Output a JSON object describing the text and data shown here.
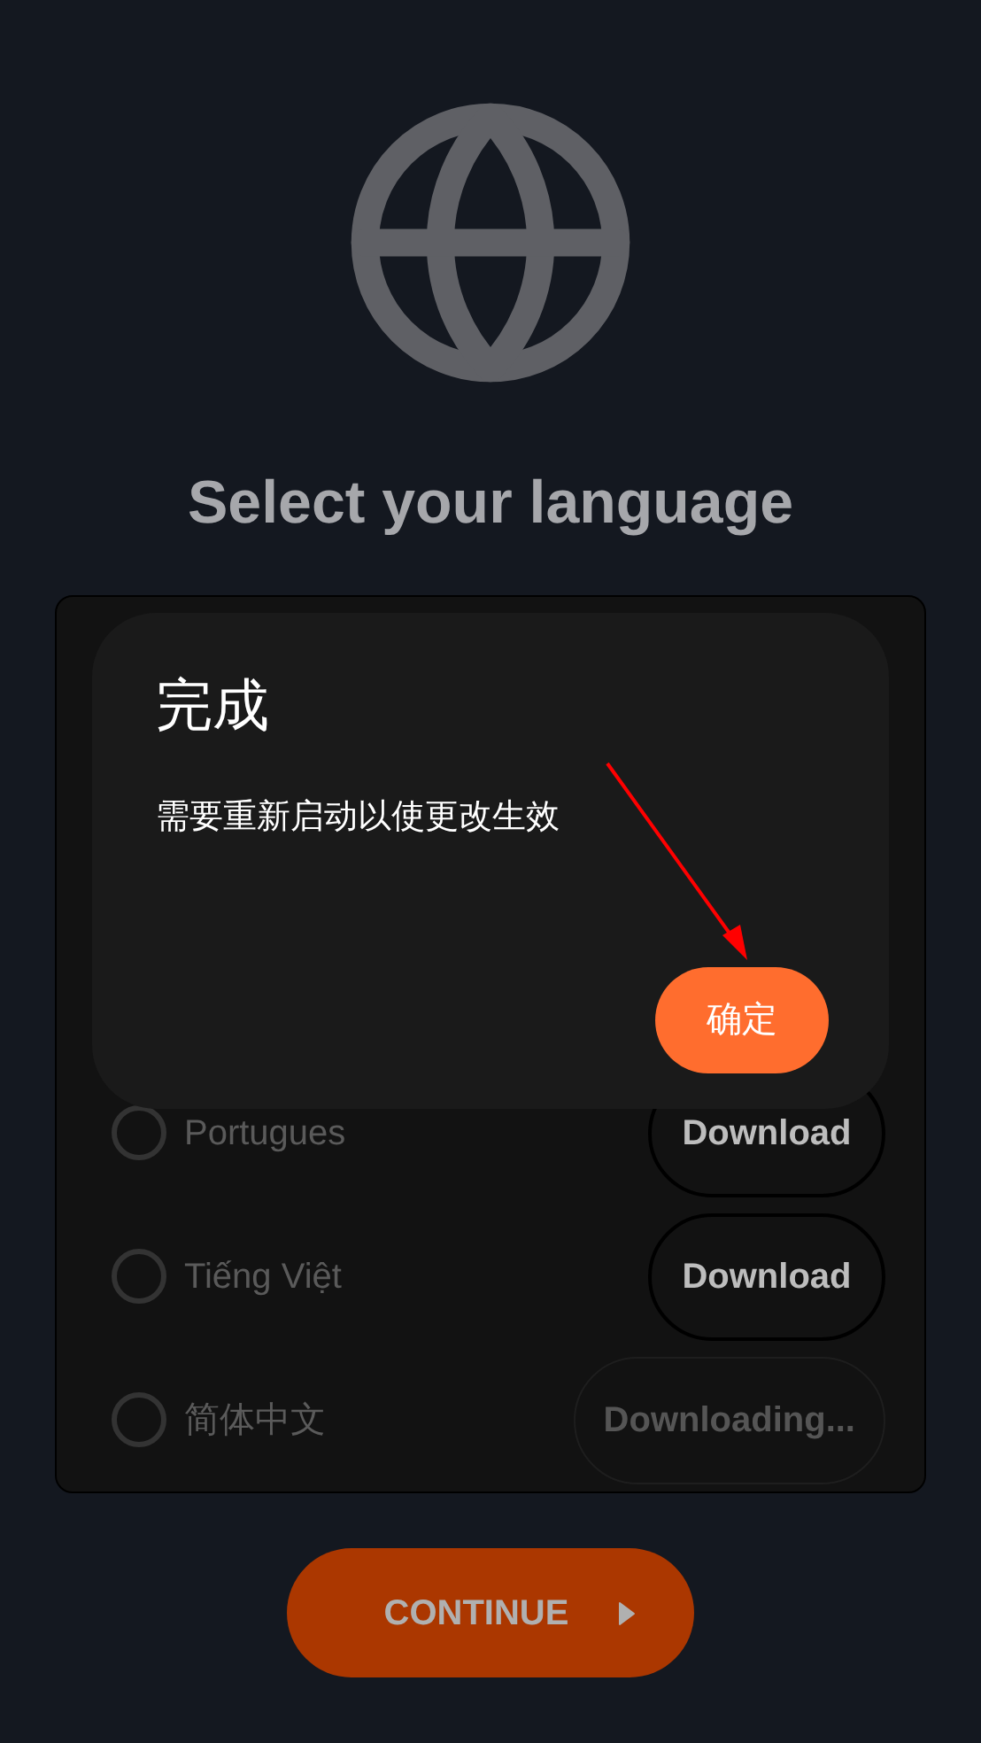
{
  "title": "Select your language",
  "languages": [
    {
      "name": "Portugues",
      "selected": false,
      "button": {
        "label": "Download",
        "disabled": false
      }
    },
    {
      "name": "Tiếng Việt",
      "selected": false,
      "button": {
        "label": "Download",
        "disabled": false
      }
    },
    {
      "name": "简体中文",
      "selected": false,
      "button": {
        "label": "Downloading...",
        "disabled": true
      }
    }
  ],
  "continue_button": {
    "label": "CONTINUE"
  },
  "dialog": {
    "title": "完成",
    "message": "需要重新启动以使更改生效",
    "confirm": "确定"
  }
}
